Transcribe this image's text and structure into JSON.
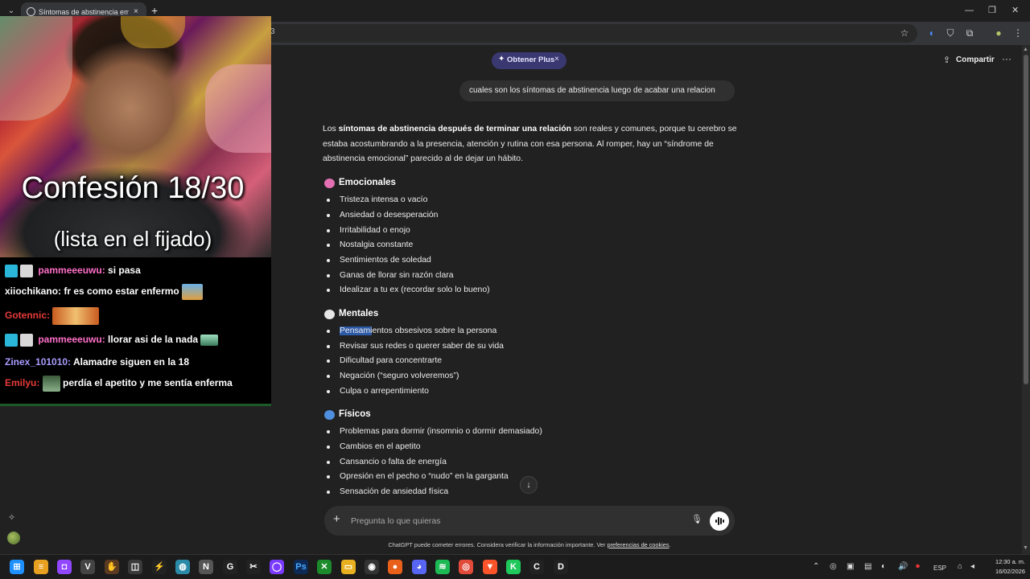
{
  "browser": {
    "tab_title": "Síntomas de abstinencia emocional",
    "tab_close": "×",
    "new_tab": "+",
    "omnibox_text": "3",
    "win_minimize": "—",
    "win_restore": "❐",
    "win_close": "✕"
  },
  "header": {
    "plus_label": "Obtener Plus",
    "plus_star": "✦",
    "plus_close": "×",
    "share_label": "Compartir",
    "more": "···"
  },
  "conversation": {
    "user_message": "cuales son los síntomas de abstinencia luego de acabar una relacion",
    "intro_pre": "Los ",
    "intro_bold": "síntomas de abstinencia después de terminar una relación",
    "intro_post": " son reales y comunes, porque tu cerebro se estaba acostumbrando a la presencia, atención y rutina con esa persona. Al romper, hay un “síndrome de abstinencia emocional” parecido al de dejar un hábito.",
    "sections": [
      {
        "title": "Emocionales",
        "emoji_color": "#e46fb3",
        "items": [
          "Tristeza intensa o vacío",
          "Ansiedad o desesperación",
          "Irritabilidad o enojo",
          "Nostalgia constante",
          "Sentimientos de soledad",
          "Ganas de llorar sin razón clara",
          "Idealizar a tu ex (recordar solo lo bueno)"
        ]
      },
      {
        "title": "Mentales",
        "emoji_color": "#e6e6e6",
        "items": [
          "Pensamientos obsesivos sobre la persona",
          "Revisar sus redes o querer saber de su vida",
          "Dificultad para concentrarte",
          "Negación (“seguro volveremos”)",
          "Culpa o arrepentimiento"
        ],
        "highlight_first": "Pensami",
        "highlight_rest": "entos obsesivos sobre la persona"
      },
      {
        "title": "Físicos",
        "emoji_color": "#4f8fe0",
        "items": [
          "Problemas para dormir (insomnio o dormir demasiado)",
          "Cambios en el apetito",
          "Cansancio o falta de energía",
          "Opresión en el pecho o “nudo” en la garganta",
          "Sensación de ansiedad física"
        ]
      }
    ]
  },
  "composer": {
    "placeholder": "Pregunta lo que quieras",
    "plus": "+",
    "scroll_down": "↓"
  },
  "footer": {
    "disclaimer_pre": "ChatGPT puede cometer errores. Considera verificar la información importante. Ver ",
    "disclaimer_link": "preferencias de cookies",
    "disclaimer_post": "."
  },
  "stream": {
    "overlay_title": "Confesión 18/30",
    "overlay_subtitle": "(lista en el fijado)",
    "chat": [
      {
        "user": "pammeeeuwu:",
        "user_color": "#ff6fc8",
        "message": "si pasa",
        "badges": true
      },
      {
        "user": "xiiochikano:",
        "user_color": "#ffffff",
        "message": "fr es como estar enfermo",
        "badges": false
      },
      {
        "user": "Gotennic:",
        "user_color": "#e83a3a",
        "message": "",
        "badges": false
      },
      {
        "user": "pammeeeuwu:",
        "user_color": "#ff6fc8",
        "message": "llorar asi de la nada",
        "badges": true
      },
      {
        "user": "Zinex_101010:",
        "user_color": "#a99cff",
        "message": "Alamadre siguen en la 18",
        "badges": false
      },
      {
        "user": "Emilyu:",
        "user_color": "#e83a3a",
        "message": "perdía el apetito y me sentía enferma",
        "badges": false
      }
    ]
  },
  "taskbar": {
    "lang": "ESP",
    "time": "12:30 a. m.",
    "date": "16/02/2026"
  },
  "colors": {
    "accent_plus": "#3a3870",
    "page_bg": "#212121",
    "user_bubble": "#303030",
    "selection": "#2d5aa7"
  }
}
